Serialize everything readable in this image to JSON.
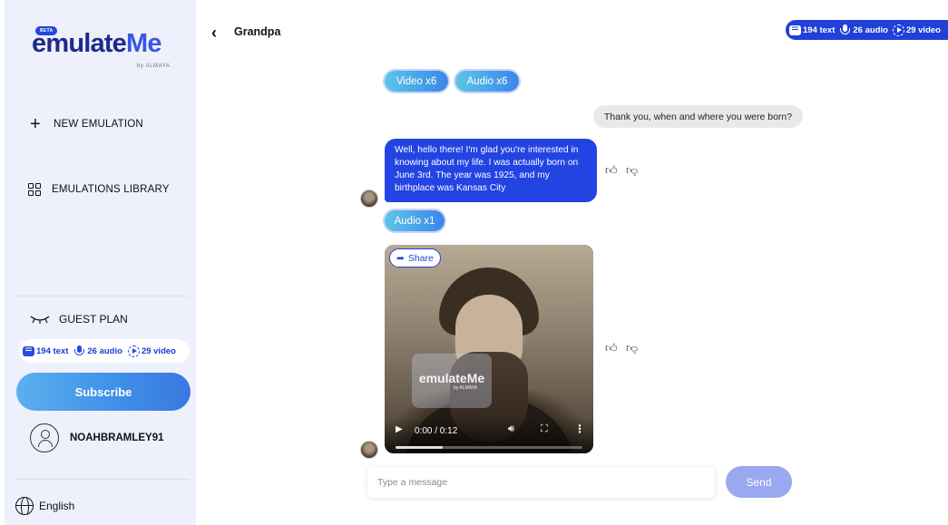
{
  "brand": {
    "beta": "BETA",
    "name_part1": "emulate",
    "name_part2": "Me",
    "byline": "by ALMAYA"
  },
  "sidebar": {
    "new_emulation": "NEW EMULATION",
    "library": "EMULATIONS LIBRARY",
    "plan": "GUEST PLAN",
    "quota": {
      "text": "194 text",
      "audio": "26 audio",
      "video": "29 video"
    },
    "subscribe": "Subscribe",
    "username": "NOAHBRAMLEY91",
    "language": "English"
  },
  "header": {
    "title": "Grandpa",
    "quota": {
      "text": "194 text",
      "audio": "26 audio",
      "video": "29 video"
    }
  },
  "chat": {
    "prev_buttons": {
      "video": "Video x6",
      "audio": "Audio x6"
    },
    "user_message": "Thank you, when and where you were born?",
    "bot_message": "Well, hello there! I'm glad you're interested in knowing about my life. I was actually born on June 3rd. The year was 1925, and my birthplace was Kansas City",
    "audio_button": "Audio x1",
    "video": {
      "share_label": "Share",
      "time": "0:00 / 0:12",
      "progress": 0.25,
      "watermark": "emulateMe",
      "watermark_by": "by ALMAYA"
    }
  },
  "composer": {
    "placeholder": "Type a message",
    "send": "Send"
  }
}
